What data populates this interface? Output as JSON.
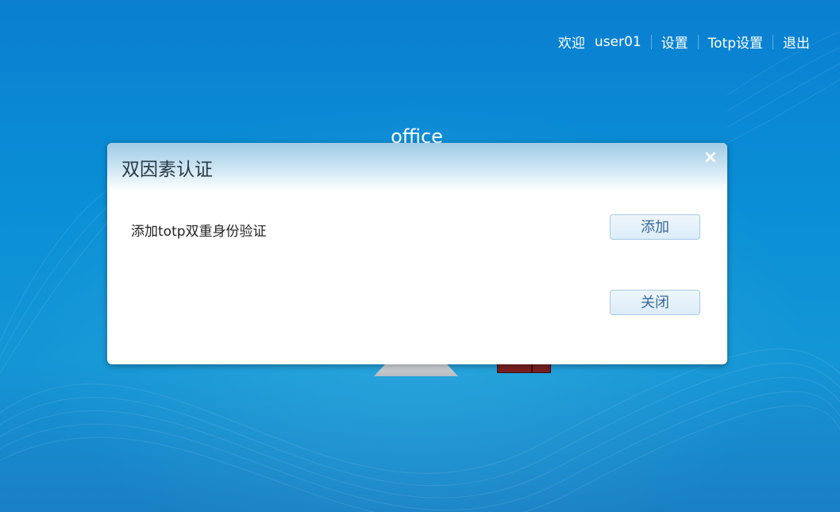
{
  "topnav": {
    "welcome": "欢迎",
    "username": "user01",
    "settings": "设置",
    "totp_settings": "Totp设置",
    "logout": "退出"
  },
  "desktop": {
    "app_label": "office"
  },
  "dialog": {
    "title": "双因素认证",
    "close_icon": "×",
    "row_label": "添加totp双重身份验证",
    "add_button": "添加",
    "close_button": "关闭"
  }
}
